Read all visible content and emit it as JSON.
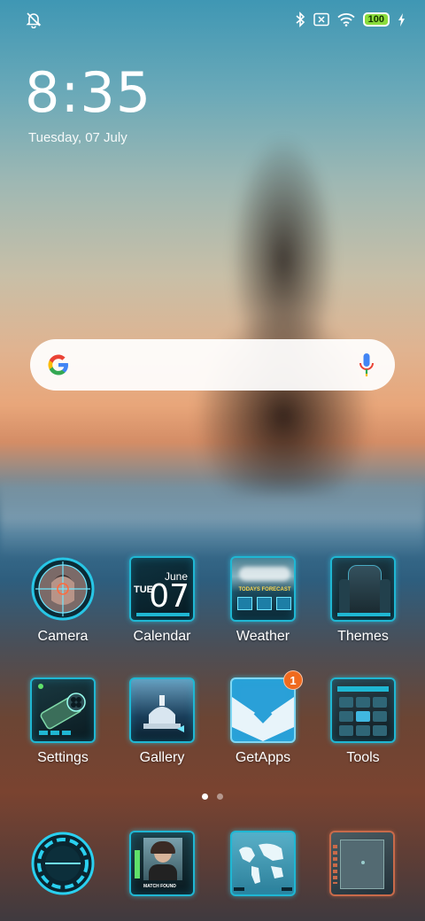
{
  "status_bar": {
    "left_icon": "alarm-off-icon",
    "right_icons": [
      "bluetooth-icon",
      "sim-x-icon",
      "wifi-icon"
    ],
    "battery_level": "100",
    "charging_icon": "bolt-icon"
  },
  "lockscreen": {
    "time": "8:35",
    "date": "Tuesday, 07 July"
  },
  "search": {
    "logo": "google-g-icon",
    "mic_icon": "mic-icon"
  },
  "calendar_icon": {
    "day": "TUE",
    "month": "June",
    "date": "07"
  },
  "weather_icon": {
    "caption": "TODAYS FORECAST"
  },
  "apps": [
    {
      "label": "Camera"
    },
    {
      "label": "Calendar"
    },
    {
      "label": "Weather"
    },
    {
      "label": "Themes"
    },
    {
      "label": "Settings"
    },
    {
      "label": "Gallery"
    },
    {
      "label": "GetApps",
      "badge": "1"
    },
    {
      "label": "Tools"
    }
  ],
  "dock": [
    {
      "name": "phone-dock-icon"
    },
    {
      "name": "contacts-dock-icon",
      "caption": "MATCH FOUND"
    },
    {
      "name": "browser-dock-icon"
    },
    {
      "name": "messages-dock-icon"
    }
  ],
  "page_indicator": {
    "pages": 2,
    "current": 1
  },
  "colors": {
    "accent": "#1fb7d3",
    "badge": "#f06a1e",
    "battery": "#8bdc3c"
  }
}
